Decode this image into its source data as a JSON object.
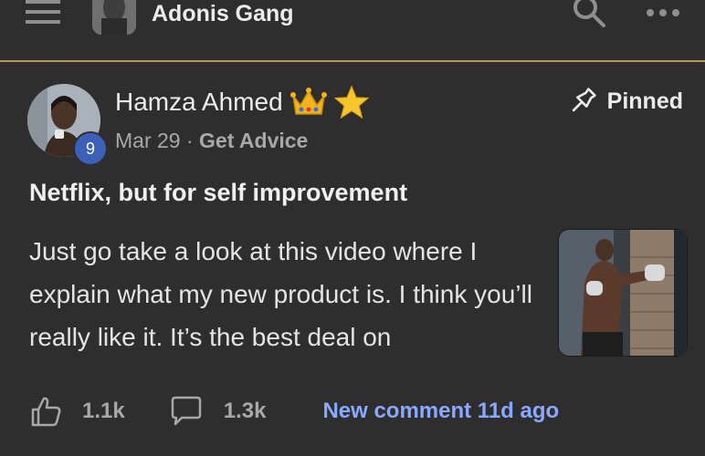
{
  "header": {
    "group_name": "Adonis Gang",
    "icons": [
      "menu-icon",
      "search-icon",
      "more-icon"
    ]
  },
  "post": {
    "author": "Hamza Ahmed",
    "level": "9",
    "date": "Mar 29",
    "separator": "·",
    "category": "Get Advice",
    "pinned_label": "Pinned",
    "title": "Netflix, but for self improvement",
    "body": "Just go take a look at this video where I explain what my new product is. I think you’ll really like it. It’s the best deal on",
    "likes": "1.1k",
    "comments": "1.3k",
    "new_comment": "New comment 11d ago"
  },
  "colors": {
    "background": "#2e2e2e",
    "accent_border": "#b59a52",
    "link": "#8aa8ff",
    "badge": "#3c5fb8"
  }
}
